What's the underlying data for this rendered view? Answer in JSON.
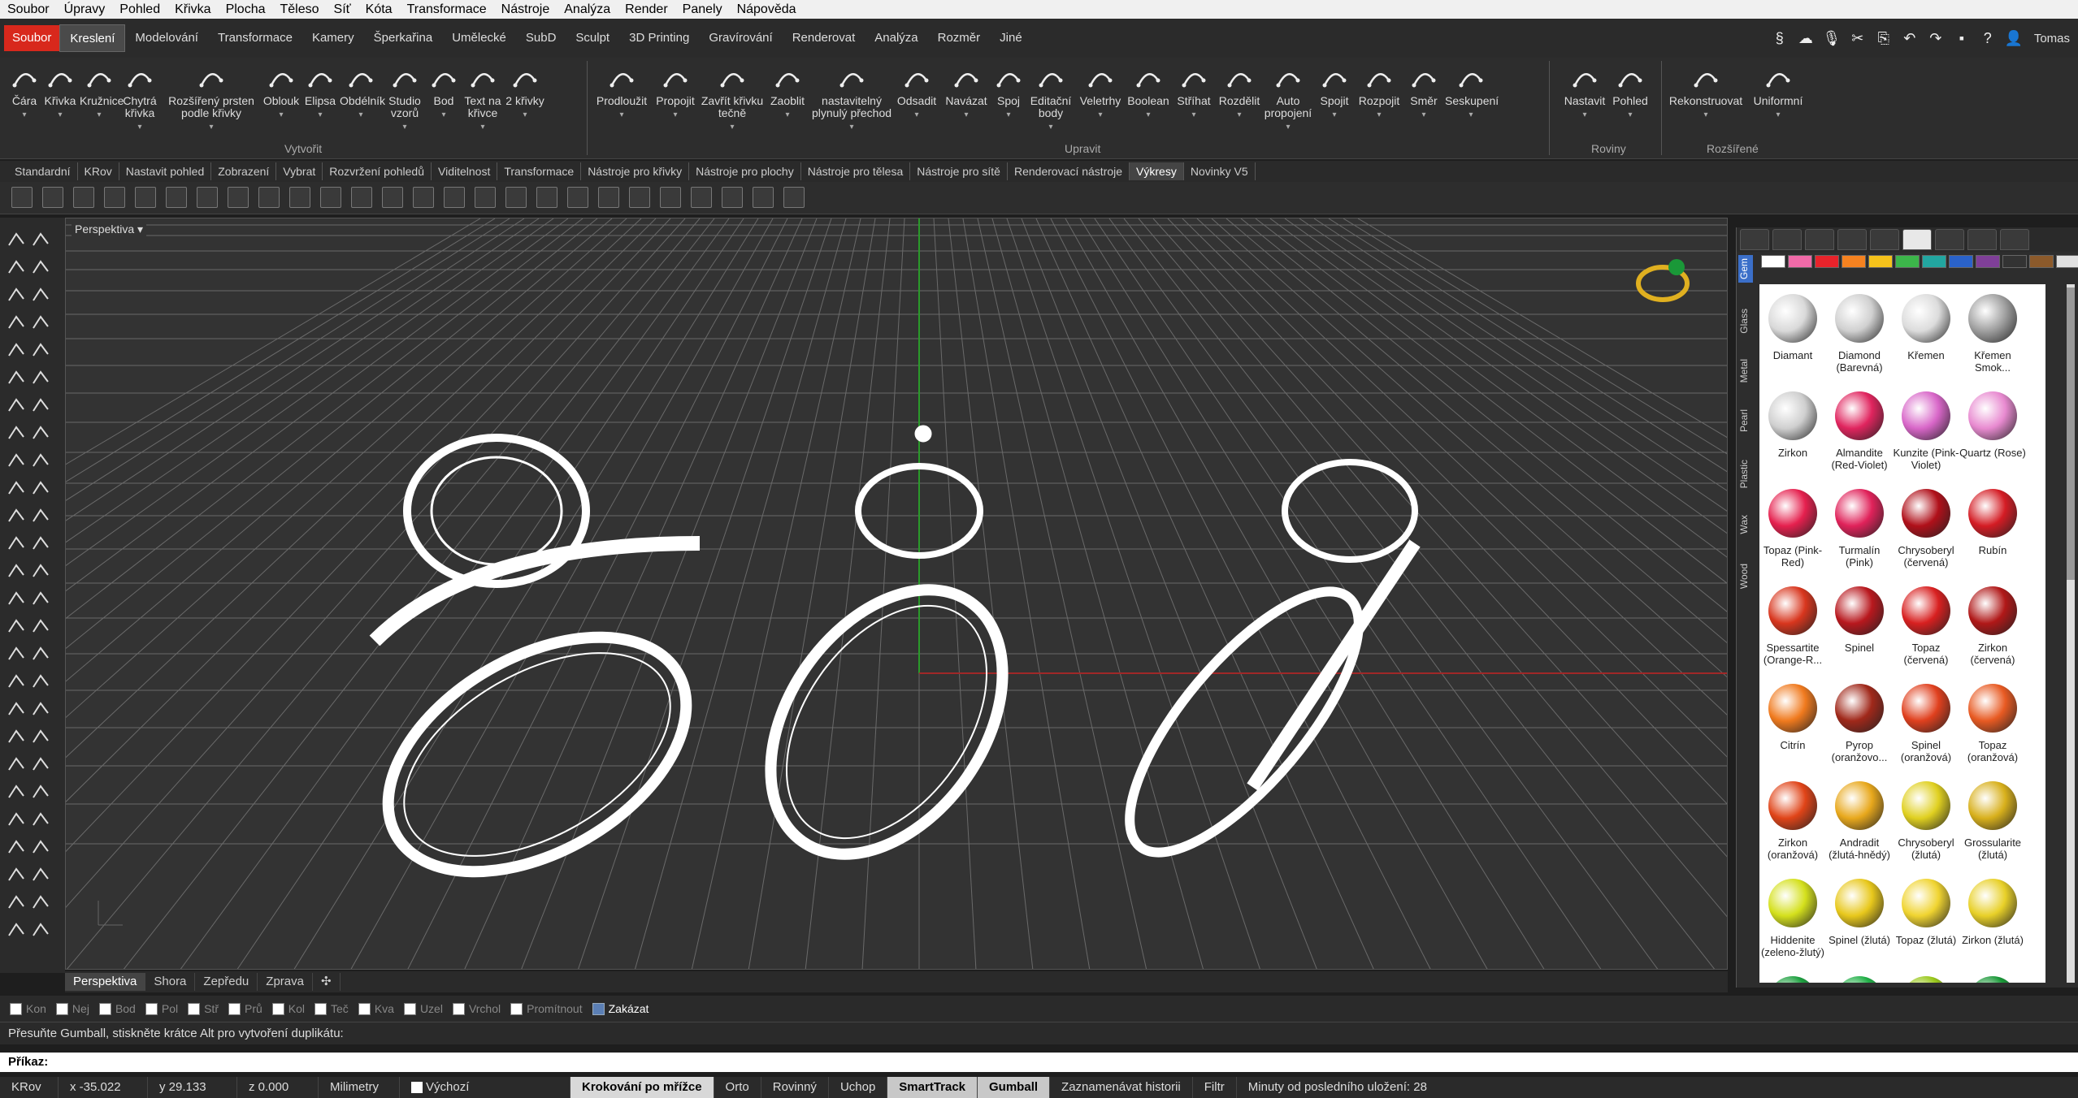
{
  "menubar": [
    "Soubor",
    "Úpravy",
    "Pohled",
    "Křivka",
    "Plocha",
    "Těleso",
    "Síť",
    "Kóta",
    "Transformace",
    "Nástroje",
    "Analýza",
    "Render",
    "Panely",
    "Nápověda"
  ],
  "ribbon_tabs": [
    "Soubor",
    "Kreslení",
    "Modelování",
    "Transformace",
    "Kamery",
    "Šperkařina",
    "Umělecké",
    "SubD",
    "Sculpt",
    "3D Printing",
    "Gravírování",
    "Renderovat",
    "Analýza",
    "Rozměr",
    "Jiné"
  ],
  "user": "Tomas",
  "ribbon": {
    "create_buttons": [
      "Čára",
      "Křivka",
      "Kružnice",
      "Chytrá křivka",
      "Rozšířený prsten podle křivky",
      "Oblouk",
      "Elipsa",
      "Obdélník",
      "Studio vzorů",
      "Bod",
      "Text na křivce",
      "2 křivky"
    ],
    "edit_buttons": [
      "Prodloužit",
      "Propojit",
      "Zavřít křivku tečně",
      "Zaoblit",
      "nastavitelný plynulý přechod",
      "Odsadit",
      "Navázat",
      "Spoj",
      "Editační body",
      "Veletrhy",
      "Boolean",
      "Stříhat",
      "Rozdělit",
      "Auto propojení",
      "Spojit",
      "Rozpojit",
      "Směr",
      "Seskupení"
    ],
    "planes_buttons": [
      "Nastavit",
      "Pohled"
    ],
    "extended_buttons": [
      "Rekonstruovat",
      "Uniformní"
    ],
    "groups": {
      "create": "Vytvořit",
      "edit": "Upravit",
      "planes": "Roviny",
      "extended": "Rozšířené"
    }
  },
  "toolbar_tabs": [
    "Standardní",
    "KRov",
    "Nastavit pohled",
    "Zobrazení",
    "Vybrat",
    "Rozvržení pohledů",
    "Viditelnost",
    "Transformace",
    "Nástroje pro křivky",
    "Nástroje pro plochy",
    "Nástroje pro tělesa",
    "Nástroje pro sítě",
    "Renderovací nástroje",
    "Výkresy",
    "Novinky V5"
  ],
  "viewport": {
    "label": "Perspektiva"
  },
  "viewport_tabs": [
    "Perspektiva",
    "Shora",
    "Zepředu",
    "Zprava"
  ],
  "osnaps": [
    {
      "label": "Kon",
      "on": false
    },
    {
      "label": "Nej",
      "on": false
    },
    {
      "label": "Bod",
      "on": false
    },
    {
      "label": "Pol",
      "on": false
    },
    {
      "label": "Stř",
      "on": false
    },
    {
      "label": "Prů",
      "on": false
    },
    {
      "label": "Kol",
      "on": false
    },
    {
      "label": "Teč",
      "on": false
    },
    {
      "label": "Kva",
      "on": false
    },
    {
      "label": "Uzel",
      "on": false
    },
    {
      "label": "Vrchol",
      "on": false
    },
    {
      "label": "Promítnout",
      "on": false
    },
    {
      "label": "Zakázat",
      "on": true
    }
  ],
  "command_history": "Přesuňte Gumball, stiskněte krátce Alt pro vytvoření duplikátu:",
  "command_prompt": "Příkaz:",
  "status": {
    "layer": "KRov",
    "x": "x -35.022",
    "y": "y 29.133",
    "z": "z 0.000",
    "units": "Milimetry",
    "default": "Výchozí",
    "grid_snap": "Krokování po mřížce",
    "ortho": "Orto",
    "planar": "Rovinný",
    "osnap": "Uchop",
    "smarttrack": "SmartTrack",
    "gumball": "Gumball",
    "history": "Zaznamenávat historii",
    "filter": "Filtr",
    "save": "Minuty od posledního uložení: 28"
  },
  "panel": {
    "categories": [
      "Gem",
      "Glass",
      "Metal",
      "Pearl",
      "Plastic",
      "Wax",
      "Wood"
    ],
    "swatch_colors": [
      "#ffffff",
      "#f06aa8",
      "#e8232b",
      "#f58220",
      "#f5c21b",
      "#3cb54a",
      "#22a6a0",
      "#2a62c9",
      "#7f3f98",
      "#333333",
      "#8c5a2b",
      "#e0e0e0"
    ],
    "gems": [
      {
        "label": "Diamant",
        "color": "#d9d9d9"
      },
      {
        "label": "Diamond (Barevná)",
        "color": "#d0d0d0"
      },
      {
        "label": "Křemen",
        "color": "#dcdcdc"
      },
      {
        "label": "Křemen Smok...",
        "color": "#a0a0a0"
      },
      {
        "label": "Zirkon",
        "color": "#cfcfcf"
      },
      {
        "label": "Almandite (Red-Violet)",
        "color": "#e0245e"
      },
      {
        "label": "Kunzite (Pink-Violet)",
        "color": "#d866c8"
      },
      {
        "label": "Quartz (Rose)",
        "color": "#e88ad0"
      },
      {
        "label": "Topaz (Pink-Red)",
        "color": "#e5204e"
      },
      {
        "label": "Turmalín (Pink)",
        "color": "#e0225a"
      },
      {
        "label": "Chrysoberyl (červená)",
        "color": "#b0101a"
      },
      {
        "label": "Rubín",
        "color": "#d41c24"
      },
      {
        "label": "Spessartite (Orange-R...",
        "color": "#d8361e"
      },
      {
        "label": "Spinel",
        "color": "#b8181e"
      },
      {
        "label": "Topaz (červená)",
        "color": "#d82020"
      },
      {
        "label": "Zirkon (červená)",
        "color": "#b01818"
      },
      {
        "label": "Citrín",
        "color": "#f07a1e"
      },
      {
        "label": "Pyrop (oranžovo...",
        "color": "#a0281a"
      },
      {
        "label": "Spinel (oranžová)",
        "color": "#e0401e"
      },
      {
        "label": "Topaz (oranžová)",
        "color": "#e85a22"
      },
      {
        "label": "Zirkon (oranžová)",
        "color": "#e04418"
      },
      {
        "label": "Andradit (žlutá-hnědý)",
        "color": "#e8a81c"
      },
      {
        "label": "Chrysoberyl (žlutá)",
        "color": "#e0d020"
      },
      {
        "label": "Grossularite (žlutá)",
        "color": "#d8b01c"
      },
      {
        "label": "Hiddenite (zeleno-žlutý)",
        "color": "#d4e01c"
      },
      {
        "label": "Spinel (žlutá)",
        "color": "#e8c81c"
      },
      {
        "label": "Topaz (žlutá)",
        "color": "#f0d430"
      },
      {
        "label": "Zirkon (žlutá)",
        "color": "#e8d028"
      },
      {
        "label": "",
        "color": "#1ea040"
      },
      {
        "label": "",
        "color": "#22b048"
      },
      {
        "label": "",
        "color": "#9ac81c"
      },
      {
        "label": "",
        "color": "#1a9838"
      }
    ]
  }
}
